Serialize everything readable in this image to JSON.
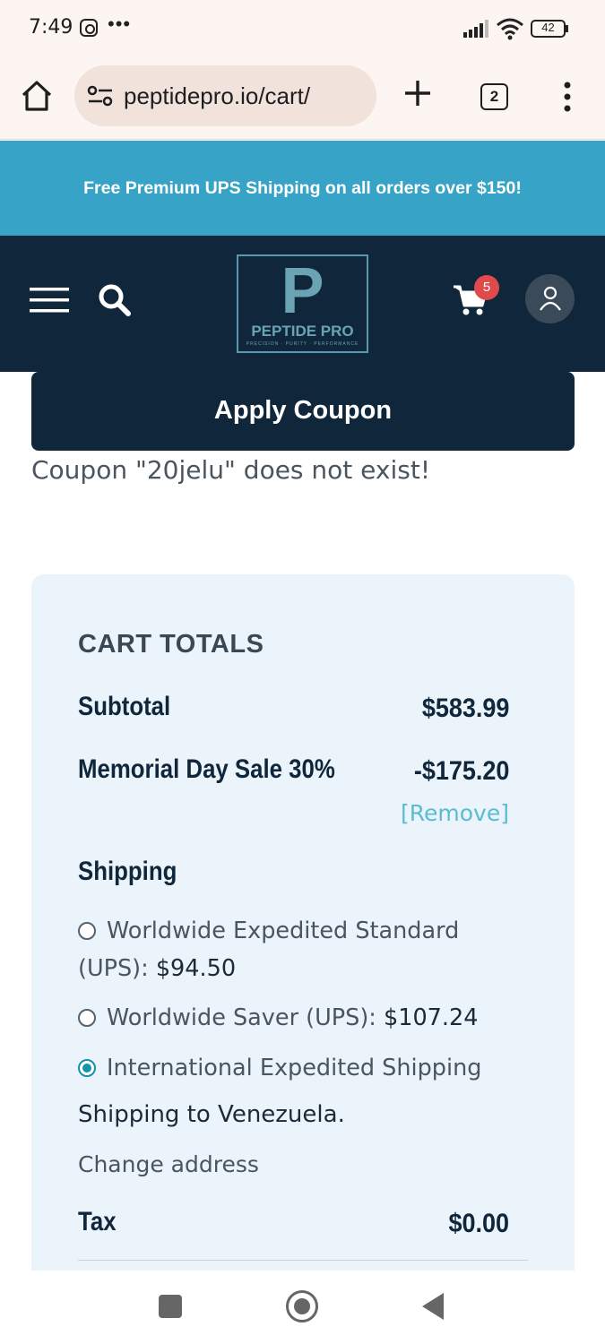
{
  "status_bar": {
    "time": "7:49",
    "more": "•••",
    "battery": "42"
  },
  "browser": {
    "url": "peptidepro.io/cart/",
    "tab_count": "2"
  },
  "promo": {
    "text": "Free Premium UPS Shipping on all orders over $150!"
  },
  "header": {
    "logo_letter": "P",
    "logo_name": "PEPTIDE PRO",
    "logo_tagline": "PRECISION · PURITY · PERFORMANCE",
    "cart_count": "5"
  },
  "coupon": {
    "apply_label": "Apply Coupon",
    "message": "Coupon \"20jelu\" does not exist!"
  },
  "cart_totals": {
    "title": "CART TOTALS",
    "subtotal_label": "Subtotal",
    "subtotal_value": "$583.99",
    "discount_label": "Memorial Day Sale 30%",
    "discount_value": "-$175.20",
    "remove_label": "[Remove]",
    "shipping_label": "Shipping",
    "shipping_options": [
      {
        "name": "Worldwide Expedited Standard (UPS):",
        "price": "$94.50",
        "selected": false
      },
      {
        "name": "Worldwide Saver (UPS):",
        "price": "$107.24",
        "selected": false
      },
      {
        "name": "International Expedited Shipping",
        "price": "",
        "selected": true
      }
    ],
    "shipping_destination": "Shipping to Venezuela.",
    "change_address": "Change address",
    "tax_label": "Tax",
    "tax_value": "$0.00"
  },
  "colors": {
    "promo_bg": "#36a3c7",
    "header_bg": "#10263a",
    "card_bg": "#ebf3fb",
    "accent": "#1593a9",
    "badge": "#e04a4a",
    "link": "#5bbcd0"
  },
  "icons": [
    "instagram-icon",
    "more-icon",
    "signal-icon",
    "wifi-icon",
    "battery-icon",
    "home-icon",
    "site-settings-icon",
    "plus-icon",
    "tabs-icon",
    "overflow-menu-icon",
    "hamburger-icon",
    "search-icon",
    "cart-icon",
    "account-icon",
    "recent-apps-icon",
    "home-nav-icon",
    "back-icon"
  ]
}
